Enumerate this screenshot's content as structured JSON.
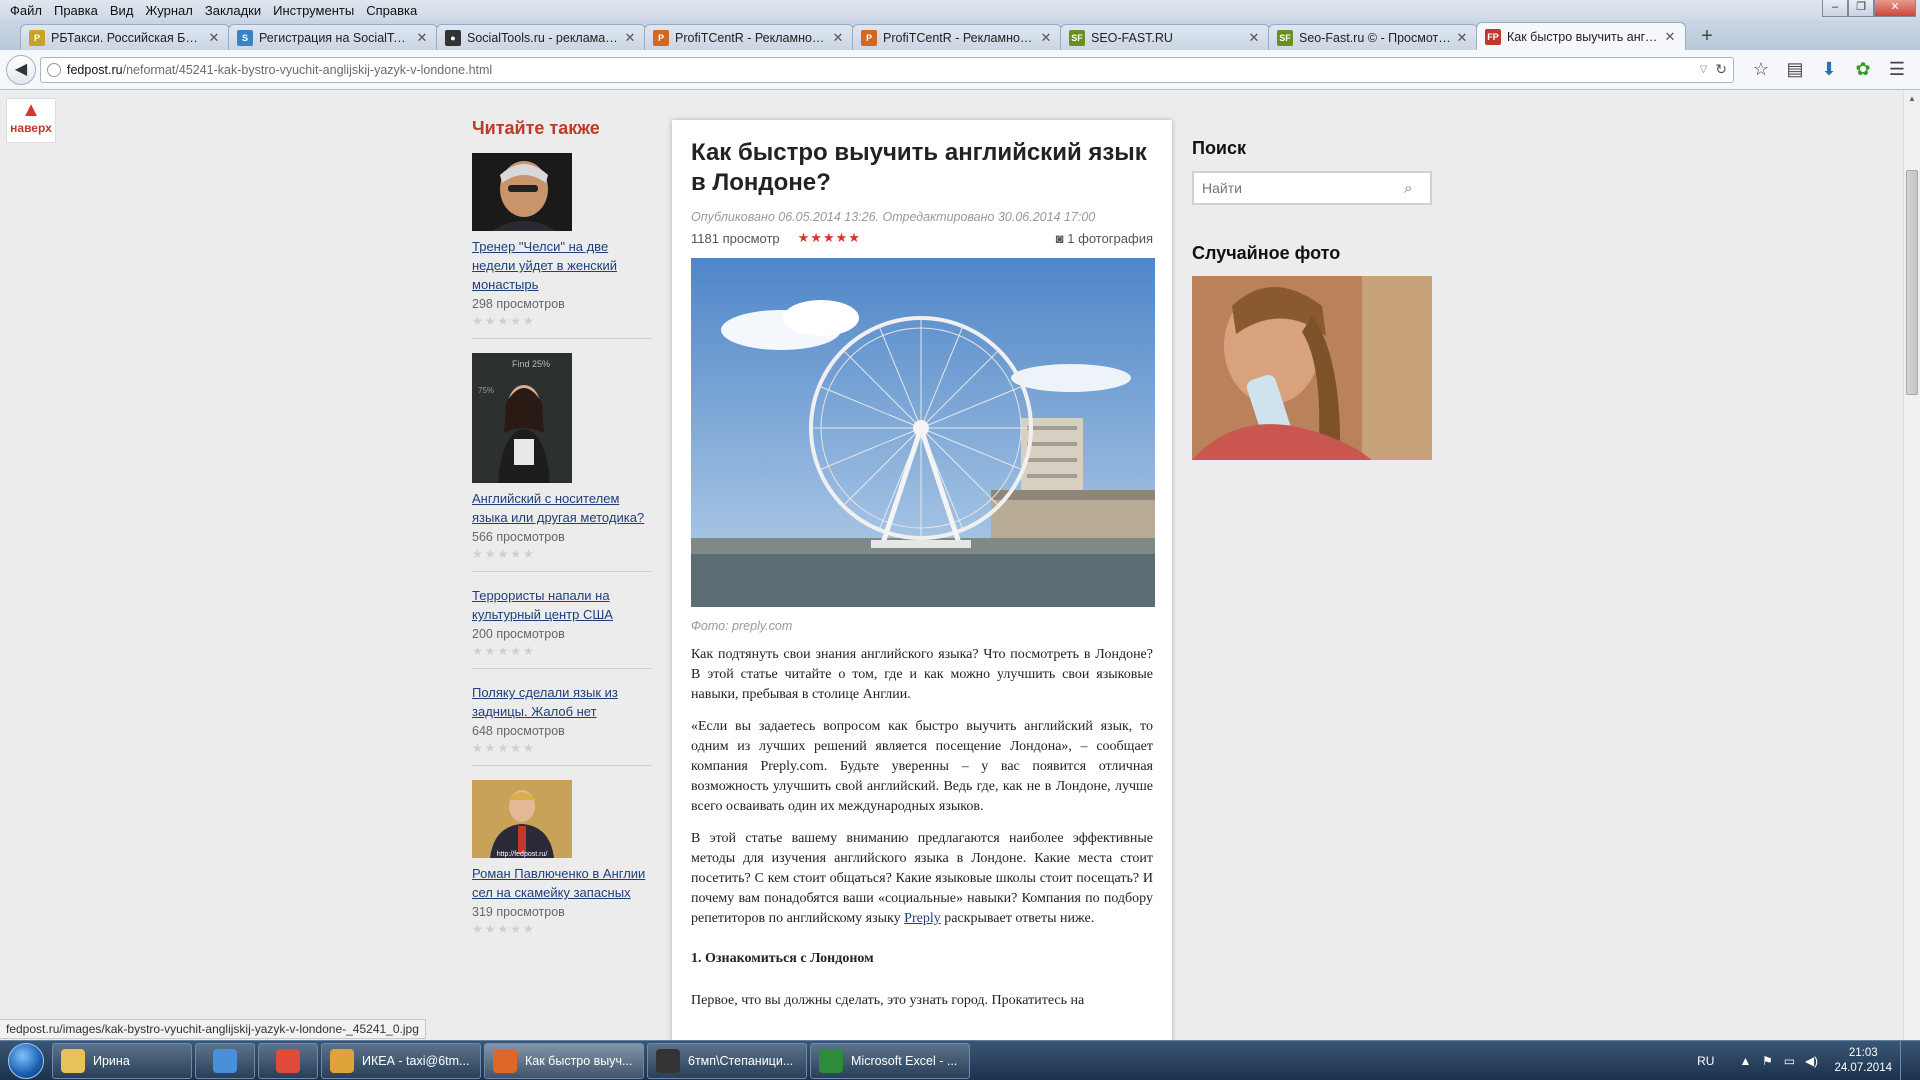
{
  "menu": [
    "Файл",
    "Правка",
    "Вид",
    "Журнал",
    "Закладки",
    "Инструменты",
    "Справка"
  ],
  "window_controls": [
    "–",
    "❐",
    "✕"
  ],
  "tabs": [
    {
      "title": "РБТакси. Российская Бир...",
      "icon_color": "#c9a22b",
      "icon_text": "Р"
    },
    {
      "title": "Регистрация на SocialTool...",
      "icon_color": "#3b82c4",
      "icon_text": "S"
    },
    {
      "title": "SocialTools.ru - реклама в...",
      "icon_color": "#333333",
      "icon_text": "●"
    },
    {
      "title": "ProfiTCentR - Рекламное ...",
      "icon_color": "#d2691e",
      "icon_text": "P"
    },
    {
      "title": "ProfiTCentR - Рекламное ...",
      "icon_color": "#d2691e",
      "icon_text": "P"
    },
    {
      "title": "SEO-FAST.RU",
      "icon_color": "#6b8e23",
      "icon_text": "SF"
    },
    {
      "title": "Seo-Fast.ru © - Просмотр...",
      "icon_color": "#6b8e23",
      "icon_text": "SF"
    },
    {
      "title": "Как быстро выучить англ...",
      "icon_color": "#c0392b",
      "icon_text": "FP"
    }
  ],
  "url": {
    "domain": "fedpost.ru",
    "path": "/neformat/45241-kak-bystro-vyuchit-anglijskij-yazyk-v-londone.html"
  },
  "totop_label": "наверх",
  "related": {
    "title": "Читайте также",
    "items": [
      {
        "link": "Тренер \"Челси\" на две недели уйдет в женский монастырь",
        "views": "298 просмотров",
        "stars": "★★★★★"
      },
      {
        "link": "Английский с носителем языка или другая методика?",
        "views": "566 просмотров",
        "stars": "★★★★★"
      },
      {
        "link": "Террористы напали на культурный центр США",
        "views": "200 просмотров",
        "stars": "★★★★★"
      },
      {
        "link": "Поляку сделали язык из задницы. Жалоб нет",
        "views": "648 просмотров",
        "stars": "★★★★★"
      },
      {
        "link": "Роман Павлюченко в Англии сел на скамейку запасных",
        "views": "319 просмотров",
        "stars": "★★★★★",
        "thumb_text": "http://fedpost.ru/"
      }
    ]
  },
  "article": {
    "title": "Как быстро выучить английский язык в Лондоне?",
    "meta": "Опубликовано 06.05.2014 13:26. Отредактировано 30.06.2014 17:00",
    "views": "1181 просмотр",
    "rating": "★★★★★",
    "photos": "1 фотография",
    "caption": "Фото: preply.com",
    "p1": "Как подтянуть свои знания английского языка? Что посмотреть в Лондоне? В этой статье читайте о том, где и как можно улучшить свои языковые навыки, пребывая в столице Англии.",
    "p2": "«Если вы задаетесь вопросом как быстро выучить английский язык, то одним из лучших решений является посещение Лондона», – сообщает компания Preply.com. Будьте уверенны – у вас появится отличная возможность улучшить свой английский. Ведь где, как не в Лондоне, лучше всего осваивать один их международных языков.",
    "p3_before": "В этой статье вашему вниманию предлагаются наиболее эффективные методы для изучения английского языка в Лондоне. Какие места стоит посетить? С кем стоит общаться? Какие языковые школы стоит посещать? И почему вам понадобятся ваши «социальные» навыки? Компания по подбору репетиторов по английскому языку ",
    "p3_link": "Preply",
    "p3_after": " раскрывает ответы ниже.",
    "h1": "1. Ознакомиться с Лондоном",
    "p4": "Первое, что вы должны сделать, это узнать город. Прокатитесь на"
  },
  "sidebar": {
    "search_title": "Поиск",
    "search_placeholder": "Найти",
    "random_title": "Случайное фото"
  },
  "status_url": "fedpost.ru/images/kak-bystro-vyuchit-anglijskij-yazyk-v-londone-_45241_0.jpg",
  "taskbar": {
    "items": [
      {
        "label": "Ирина",
        "icon_color": "#e8c15a",
        "width": 140
      },
      {
        "label": "",
        "icon_color": "#4a90d9",
        "width": 60
      },
      {
        "label": "",
        "icon_color": "#e04a3a",
        "width": 60
      },
      {
        "label": "ИКЕА - taxi@6tm...",
        "icon_color": "#e0a23a",
        "width": 160
      },
      {
        "label": "Как быстро выуч...",
        "icon_color": "#e0672a",
        "width": 160,
        "active": true
      },
      {
        "label": "6тмп\\Степаници...",
        "icon_color": "#333333",
        "width": 160
      },
      {
        "label": "Microsoft Excel - ...",
        "icon_color": "#2e8b3a",
        "width": 160
      }
    ],
    "lang": "RU",
    "time": "21:03",
    "date": "24.07.2014"
  }
}
